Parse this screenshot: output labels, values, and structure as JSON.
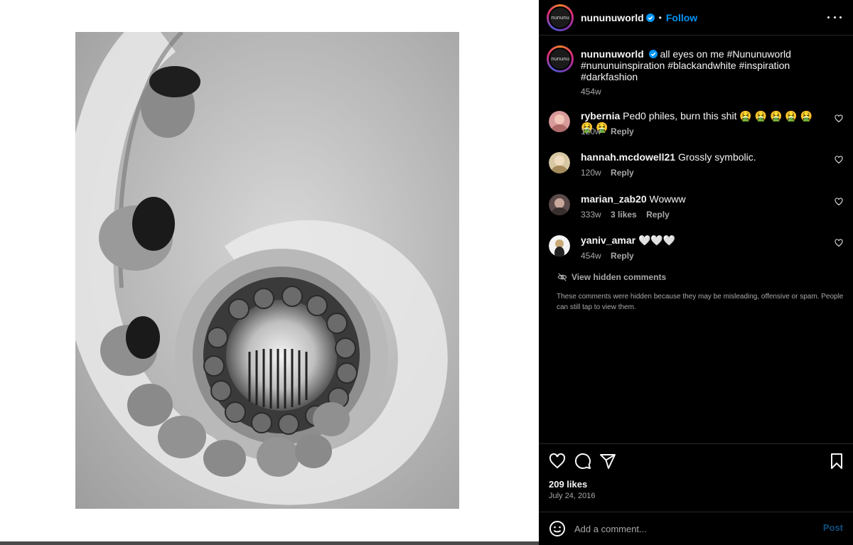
{
  "post": {
    "username": "nununuworld",
    "avatar_text": "nununu",
    "follow_label": "Follow",
    "separator": "•",
    "caption": "all eyes on me #Nununuworld #nununuinspiration #blackandwhite #inspiration #darkfashion",
    "caption_age": "454w",
    "likes": "209 likes",
    "date": "July 24, 2016"
  },
  "comments": [
    {
      "user": "rybernia",
      "text": "Ped0 philes, burn this shit 🤮 🤮 🤮 🤮 🤮 🤮 🤮",
      "age": "120w",
      "likes": "",
      "reply": "Reply"
    },
    {
      "user": "hannah.mcdowell21",
      "text": "Grossly symbolic.",
      "age": "120w",
      "likes": "",
      "reply": "Reply"
    },
    {
      "user": "marian_zab20",
      "text": "Wowww",
      "age": "333w",
      "likes": "3 likes",
      "reply": "Reply"
    },
    {
      "user": "yaniv_amar",
      "text": "🤍🤍🤍",
      "age": "454w",
      "likes": "",
      "reply": "Reply"
    }
  ],
  "hidden": {
    "label": "View hidden comments",
    "note": "These comments were hidden because they may be misleading, offensive or spam. People can still tap to view them."
  },
  "add_comment": {
    "placeholder": "Add a comment...",
    "post_label": "Post"
  },
  "colors": {
    "panel_bg": "#000000",
    "link_blue": "#0095f6",
    "muted": "#a8a8a8"
  }
}
